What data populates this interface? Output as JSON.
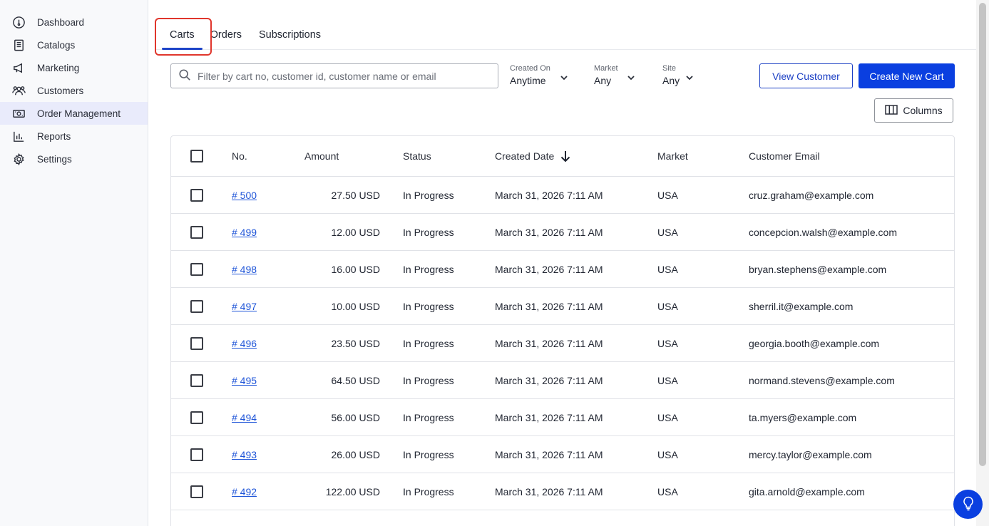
{
  "sidebar": {
    "items": [
      {
        "label": "Dashboard",
        "icon": "dashboard-icon",
        "active": false
      },
      {
        "label": "Catalogs",
        "icon": "catalog-icon",
        "active": false
      },
      {
        "label": "Marketing",
        "icon": "megaphone-icon",
        "active": false
      },
      {
        "label": "Customers",
        "icon": "customers-icon",
        "active": false
      },
      {
        "label": "Order Management",
        "icon": "order-management-icon",
        "active": true
      },
      {
        "label": "Reports",
        "icon": "reports-icon",
        "active": false
      },
      {
        "label": "Settings",
        "icon": "gear-icon",
        "active": false
      }
    ]
  },
  "tabs": [
    {
      "label": "Carts",
      "active": true
    },
    {
      "label": "Orders",
      "active": false
    },
    {
      "label": "Subscriptions",
      "active": false
    }
  ],
  "search": {
    "placeholder": "Filter by cart no, customer id, customer name or email",
    "value": ""
  },
  "filters": {
    "created_on": {
      "label": "Created On",
      "value": "Anytime"
    },
    "market": {
      "label": "Market",
      "value": "Any"
    },
    "site": {
      "label": "Site",
      "value": "Any"
    }
  },
  "buttons": {
    "view_customer": "View Customer",
    "create_new_cart": "Create New Cart",
    "columns": "Columns"
  },
  "table": {
    "headers": {
      "no": "No.",
      "amount": "Amount",
      "status": "Status",
      "created_date": "Created Date",
      "market": "Market",
      "customer_email": "Customer Email"
    },
    "sort": {
      "column": "created_date",
      "direction": "descending"
    },
    "rows": [
      {
        "no": "# 500",
        "amount": "27.50 USD",
        "status": "In Progress",
        "created": "March 31, 2026 7:11 AM",
        "market": "USA",
        "email": "cruz.graham@example.com"
      },
      {
        "no": "# 499",
        "amount": "12.00 USD",
        "status": "In Progress",
        "created": "March 31, 2026 7:11 AM",
        "market": "USA",
        "email": "concepcion.walsh@example.com"
      },
      {
        "no": "# 498",
        "amount": "16.00 USD",
        "status": "In Progress",
        "created": "March 31, 2026 7:11 AM",
        "market": "USA",
        "email": "bryan.stephens@example.com"
      },
      {
        "no": "# 497",
        "amount": "10.00 USD",
        "status": "In Progress",
        "created": "March 31, 2026 7:11 AM",
        "market": "USA",
        "email": "sherril.it@example.com"
      },
      {
        "no": "# 496",
        "amount": "23.50 USD",
        "status": "In Progress",
        "created": "March 31, 2026 7:11 AM",
        "market": "USA",
        "email": "georgia.booth@example.com"
      },
      {
        "no": "# 495",
        "amount": "64.50 USD",
        "status": "In Progress",
        "created": "March 31, 2026 7:11 AM",
        "market": "USA",
        "email": "normand.stevens@example.com"
      },
      {
        "no": "# 494",
        "amount": "56.00 USD",
        "status": "In Progress",
        "created": "March 31, 2026 7:11 AM",
        "market": "USA",
        "email": "ta.myers@example.com"
      },
      {
        "no": "# 493",
        "amount": "26.00 USD",
        "status": "In Progress",
        "created": "March 31, 2026 7:11 AM",
        "market": "USA",
        "email": "mercy.taylor@example.com"
      },
      {
        "no": "# 492",
        "amount": "122.00 USD",
        "status": "In Progress",
        "created": "March 31, 2026 7:11 AM",
        "market": "USA",
        "email": "gita.arnold@example.com"
      }
    ]
  },
  "colors": {
    "primary": "#0a3fe0",
    "link": "#1f55d8",
    "highlight": "#e0362c",
    "active_nav": "#e9ebfb"
  }
}
